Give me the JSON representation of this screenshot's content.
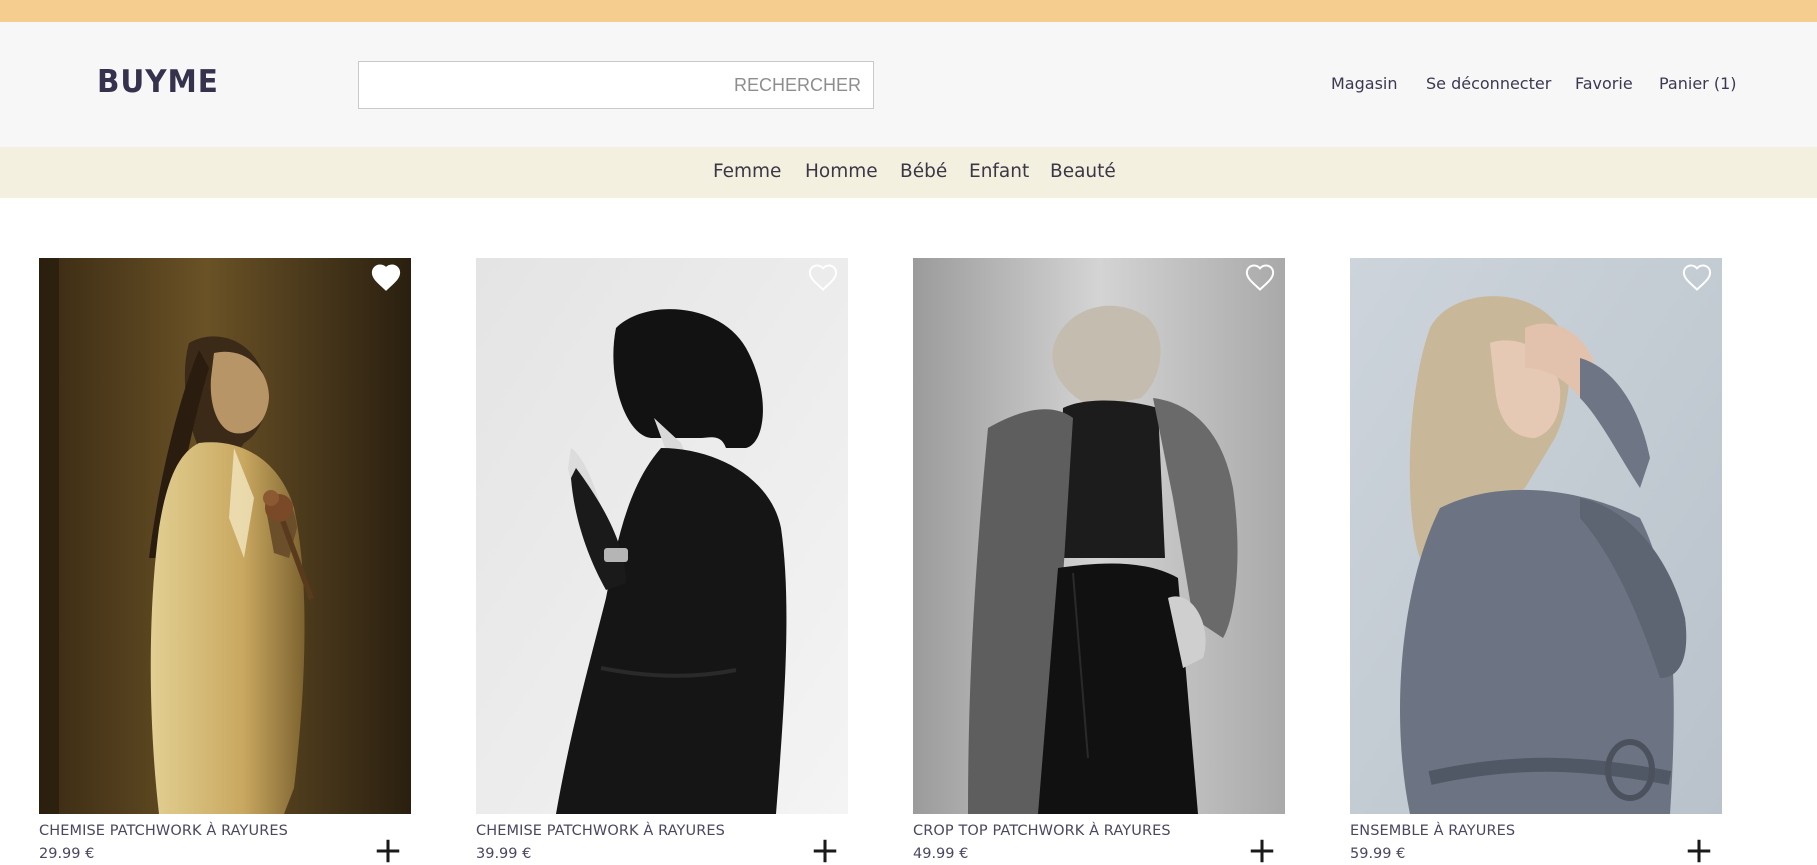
{
  "brand": {
    "name": "BUYME"
  },
  "search": {
    "placeholder": "RECHERCHER",
    "value": ""
  },
  "top_nav": [
    {
      "label": "Magasin"
    },
    {
      "label": "Se déconnecter"
    },
    {
      "label": "Favorie"
    },
    {
      "label": "Panier (1)"
    }
  ],
  "categories": [
    {
      "label": "Femme"
    },
    {
      "label": "Homme"
    },
    {
      "label": "Bébé"
    },
    {
      "label": "Enfant"
    },
    {
      "label": "Beauté"
    }
  ],
  "products": [
    {
      "name": "CHEMISE PATCHWORK À RAYURES",
      "price": "29.99 €",
      "favorited": true,
      "fav_icon": "heart-icon",
      "add_icon": "plus-icon"
    },
    {
      "name": "CHEMISE PATCHWORK À RAYURES",
      "price": "39.99 €",
      "favorited": false,
      "fav_icon": "heart-icon",
      "add_icon": "plus-icon"
    },
    {
      "name": "CROP TOP PATCHWORK À RAYURES",
      "price": "49.99 €",
      "favorited": false,
      "fav_icon": "heart-icon",
      "add_icon": "plus-icon"
    },
    {
      "name": "ENSEMBLE À RAYURES",
      "price": "59.99 €",
      "favorited": false,
      "fav_icon": "heart-icon",
      "add_icon": "plus-icon"
    }
  ],
  "colors": {
    "top_strip": "#f4cd8f",
    "header_bg": "#f7f7f7",
    "category_bar": "#f4f0df",
    "text": "#3b3950"
  }
}
